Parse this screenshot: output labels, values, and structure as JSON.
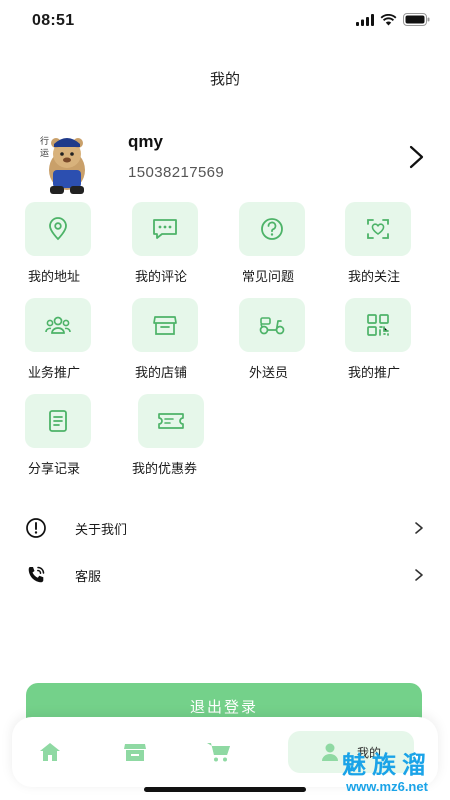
{
  "status_bar": {
    "time": "08:51"
  },
  "page": {
    "title": "我的"
  },
  "profile": {
    "username": "qmy",
    "phone": "15038217569"
  },
  "grid": [
    {
      "label": "我的地址",
      "icon": "location-pin-icon"
    },
    {
      "label": "我的评论",
      "icon": "comment-icon"
    },
    {
      "label": "常见问题",
      "icon": "question-icon"
    },
    {
      "label": "我的关注",
      "icon": "follow-heart-icon"
    },
    {
      "label": "业务推广",
      "icon": "team-icon"
    },
    {
      "label": "我的店铺",
      "icon": "store-icon"
    },
    {
      "label": "外送员",
      "icon": "scooter-icon"
    },
    {
      "label": "我的推广",
      "icon": "qrcode-icon"
    },
    {
      "label": "分享记录",
      "icon": "document-icon"
    },
    {
      "label": "我的优惠券",
      "icon": "coupon-icon"
    }
  ],
  "menu": [
    {
      "label": "关于我们",
      "icon": "info-icon"
    },
    {
      "label": "客服",
      "icon": "phone-call-icon"
    }
  ],
  "logout": {
    "label": "退出登录"
  },
  "tabbar": {
    "active_label": "我的"
  },
  "watermark": {
    "title": "魅族溜",
    "url": "www.mz6.net"
  },
  "colors": {
    "accent": "#74d18a",
    "tile_bg": "#e6f7ea",
    "icon": "#4db368",
    "watermark": "#1aa3e8"
  }
}
